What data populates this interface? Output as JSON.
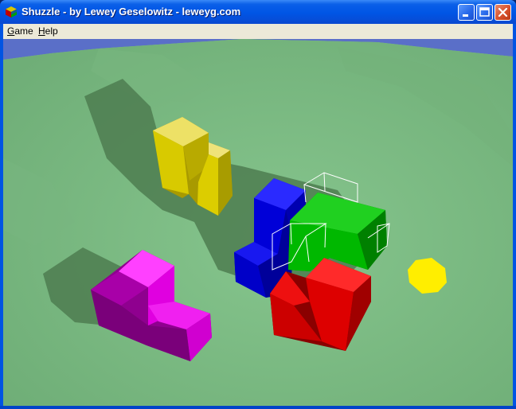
{
  "window": {
    "title": "Shuzzle - by Lewey Geselowitz - leweyg.com",
    "icon": "app-cube-icon"
  },
  "caption_buttons": {
    "minimize": "minimize-icon",
    "maximize": "maximize-icon",
    "close": "close-icon"
  },
  "menu": {
    "items": [
      {
        "label": "Game",
        "accesskey": "G"
      },
      {
        "label": "Help",
        "accesskey": "H"
      }
    ]
  },
  "scene": {
    "ground_color": "#7fbf86",
    "sky_color": "#5a6fc8",
    "pieces": [
      {
        "name": "yellow-piece",
        "color": "#e2d400"
      },
      {
        "name": "magenta-piece",
        "color": "#d400d4"
      },
      {
        "name": "blue-piece",
        "color": "#0000cc"
      },
      {
        "name": "green-piece",
        "color": "#00b000"
      },
      {
        "name": "red-piece",
        "color": "#cc0000"
      }
    ],
    "cursor_color": "#ffee00"
  }
}
